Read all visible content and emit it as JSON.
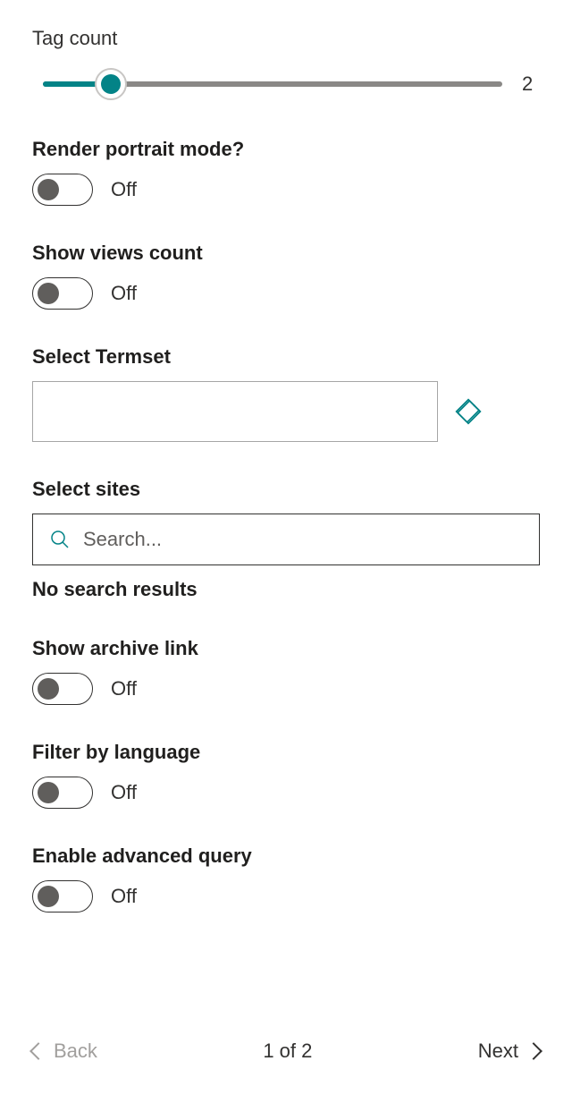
{
  "slider": {
    "label": "Tag count",
    "value": "2"
  },
  "toggles": {
    "portrait": {
      "label": "Render portrait mode?",
      "state": "Off"
    },
    "views": {
      "label": "Show views count",
      "state": "Off"
    },
    "archive": {
      "label": "Show archive link",
      "state": "Off"
    },
    "language": {
      "label": "Filter by language",
      "state": "Off"
    },
    "advanced": {
      "label": "Enable advanced query",
      "state": "Off"
    }
  },
  "termset": {
    "label": "Select Termset",
    "value": ""
  },
  "sites": {
    "label": "Select sites",
    "placeholder": "Search...",
    "no_results": "No search results"
  },
  "footer": {
    "back": "Back",
    "page": "1 of 2",
    "next": "Next"
  }
}
